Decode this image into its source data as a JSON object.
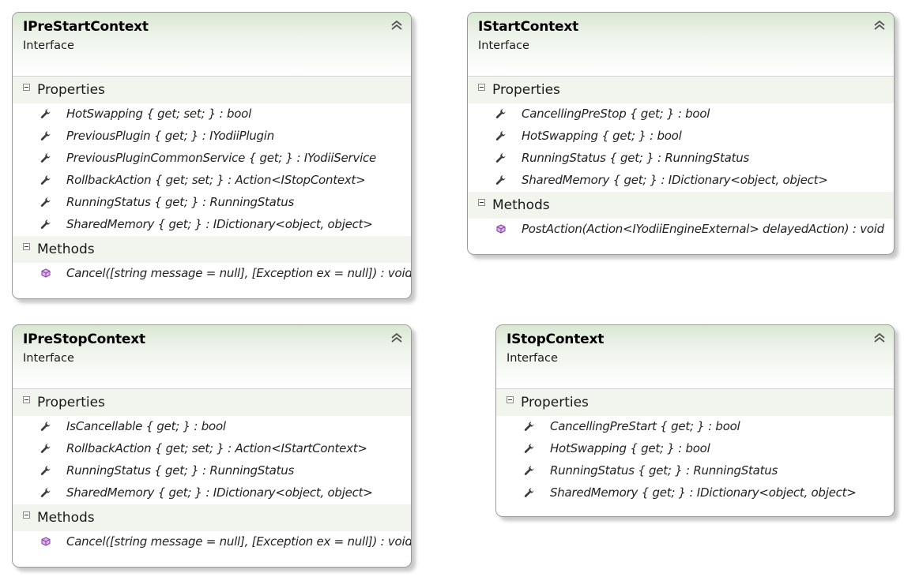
{
  "boxes": [
    {
      "name": "IPreStartContext",
      "kind": "Interface",
      "sections": [
        {
          "label": "Properties",
          "icon": "wrench-icon",
          "members": [
            "HotSwapping { get; set; } : bool",
            "PreviousPlugin { get; } : IYodiiPlugin",
            "PreviousPluginCommonService { get; } : IYodiiService",
            "RollbackAction { get; set; } : Action<IStopContext>",
            "RunningStatus { get; } : RunningStatus",
            "SharedMemory { get; } : IDictionary<object, object>"
          ]
        },
        {
          "label": "Methods",
          "icon": "method-cube-icon",
          "members": [
            "Cancel([string message = null], [Exception ex = null]) : void"
          ]
        }
      ]
    },
    {
      "name": "IStartContext",
      "kind": "Interface",
      "sections": [
        {
          "label": "Properties",
          "icon": "wrench-icon",
          "members": [
            "CancellingPreStop { get; } : bool",
            "HotSwapping { get; } : bool",
            "RunningStatus { get; } : RunningStatus",
            "SharedMemory { get; } : IDictionary<object, object>"
          ]
        },
        {
          "label": "Methods",
          "icon": "method-cube-icon",
          "members": [
            "PostAction(Action<IYodiiEngineExternal> delayedAction) : void"
          ]
        }
      ]
    },
    {
      "name": "IPreStopContext",
      "kind": "Interface",
      "sections": [
        {
          "label": "Properties",
          "icon": "wrench-icon",
          "members": [
            "IsCancellable { get; } : bool",
            "RollbackAction { get; set; } : Action<IStartContext>",
            "RunningStatus { get; } : RunningStatus",
            "SharedMemory { get; } : IDictionary<object, object>"
          ]
        },
        {
          "label": "Methods",
          "icon": "method-cube-icon",
          "members": [
            "Cancel([string message = null], [Exception ex = null]) : void"
          ]
        }
      ]
    },
    {
      "name": "IStopContext",
      "kind": "Interface",
      "sections": [
        {
          "label": "Properties",
          "icon": "wrench-icon",
          "members": [
            "CancellingPreStart { get; } : bool",
            "HotSwapping { get; } : bool",
            "RunningStatus { get; } : RunningStatus",
            "SharedMemory { get; } : IDictionary<object, object>"
          ]
        }
      ]
    }
  ],
  "colors": {
    "header_green": "#d9e7d2",
    "section_bg": "#f1f5ee",
    "method_icon": "#8e44ad",
    "wrench_icon": "#3a3a3a"
  }
}
